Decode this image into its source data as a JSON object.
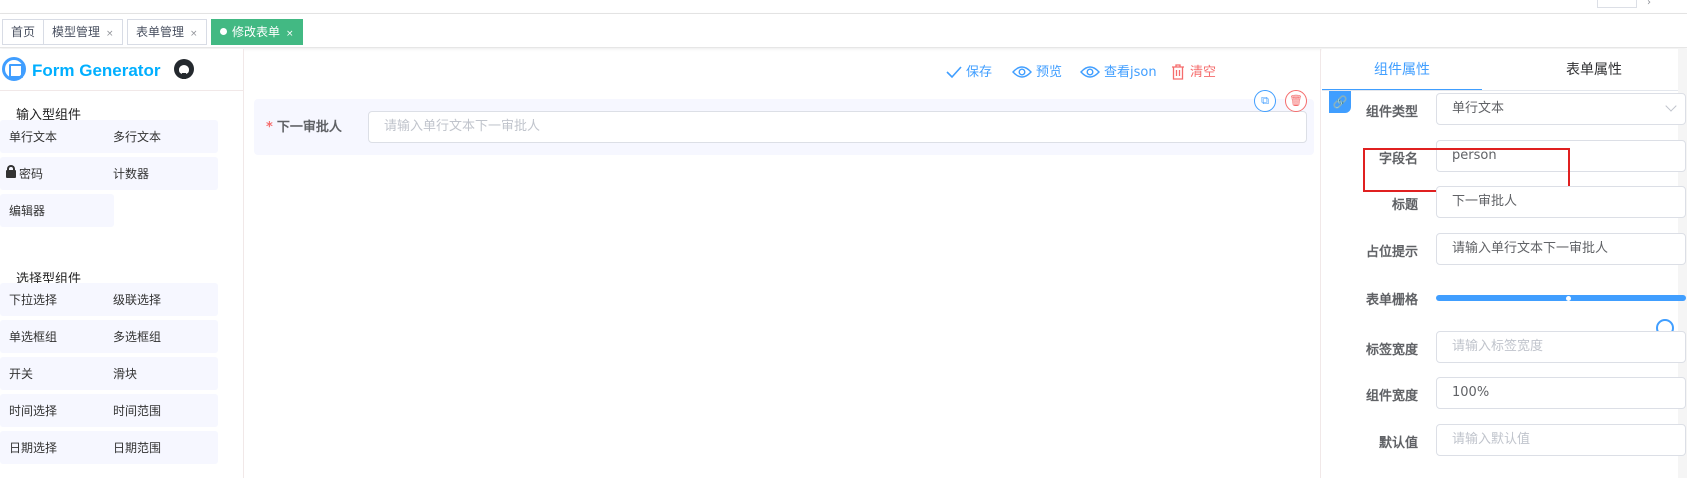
{
  "tags": [
    {
      "label": "首页",
      "closable": false
    },
    {
      "label": "模型管理",
      "closable": true
    },
    {
      "label": "表单管理",
      "closable": true
    },
    {
      "label": "修改表单",
      "closable": true,
      "active": true
    }
  ],
  "logo": {
    "text": "Form Generator",
    "github_icon": "github-icon"
  },
  "components": {
    "input_title": "输入型组件",
    "input_items": [
      "单行文本",
      "多行文本",
      "密码",
      "计数器",
      "编辑器"
    ],
    "select_title": "选择型组件",
    "select_items": [
      "下拉选择",
      "级联选择",
      "单选框组",
      "多选框组",
      "开关",
      "滑块",
      "时间选择",
      "时间范围",
      "日期选择",
      "日期范围"
    ]
  },
  "toolbar": {
    "save": "保存",
    "preview": "预览",
    "view_json": "查看json",
    "clear": "清空"
  },
  "canvas": {
    "field_label": "下一审批人",
    "required_mark": "*",
    "placeholder": "请输入单行文本下一审批人",
    "copy_icon": "copy-icon",
    "delete_icon": "delete-icon"
  },
  "properties": {
    "tabs": [
      "组件属性",
      "表单属性"
    ],
    "active_tab": 0,
    "rows": [
      {
        "label": "组件类型",
        "value": "单行文本",
        "type": "select"
      },
      {
        "label": "字段名",
        "value": "person",
        "type": "input"
      },
      {
        "label": "标题",
        "value": "下一审批人",
        "type": "input"
      },
      {
        "label": "占位提示",
        "value": "请输入单行文本下一审批人",
        "type": "input"
      },
      {
        "label": "表单栅格",
        "value": 24,
        "max": 24,
        "type": "slider"
      },
      {
        "label": "标签宽度",
        "placeholder": "请输入标签宽度",
        "type": "input"
      },
      {
        "label": "组件宽度",
        "value": "100%",
        "type": "input"
      },
      {
        "label": "默认值",
        "placeholder": "请输入默认值",
        "type": "input"
      }
    ]
  },
  "colors": {
    "primary": "#409eff",
    "danger": "#f56c6c",
    "active_tag": "#42b983",
    "logo": "#00afff",
    "highlight": "#e02020"
  }
}
